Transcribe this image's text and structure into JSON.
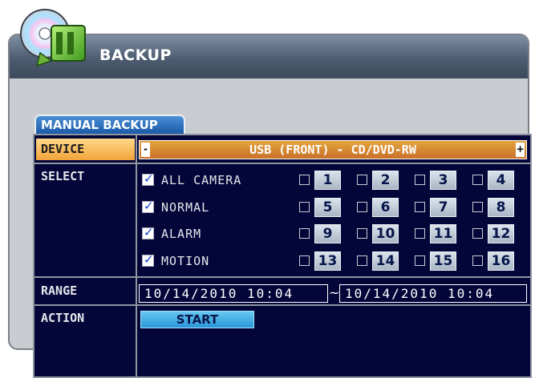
{
  "window": {
    "title": "BACKUP"
  },
  "tab": {
    "label": "MANUAL BACKUP"
  },
  "labels": {
    "device": "DEVICE",
    "select": "SELECT",
    "range": "RANGE",
    "action": "ACTION"
  },
  "device": {
    "value": "USB (FRONT) - CD/DVD-RW",
    "prev": "-",
    "next": "+"
  },
  "select": {
    "types": [
      {
        "label": "ALL CAMERA",
        "checked": true
      },
      {
        "label": "NORMAL",
        "checked": true
      },
      {
        "label": "ALARM",
        "checked": true
      },
      {
        "label": "MOTION",
        "checked": true
      }
    ],
    "cameras": [
      [
        "1",
        "2",
        "3",
        "4"
      ],
      [
        "5",
        "6",
        "7",
        "8"
      ],
      [
        "9",
        "10",
        "11",
        "12"
      ],
      [
        "13",
        "14",
        "15",
        "16"
      ]
    ]
  },
  "range": {
    "start": "10/14/2010 10:04",
    "separator": "~",
    "end": "10/14/2010 10:04"
  },
  "action": {
    "start_label": "START"
  },
  "colors": {
    "panel": "#04063a",
    "device_bar": "#d8853a",
    "start_button": "#3aa7e2",
    "tab": "#1f62b2"
  }
}
